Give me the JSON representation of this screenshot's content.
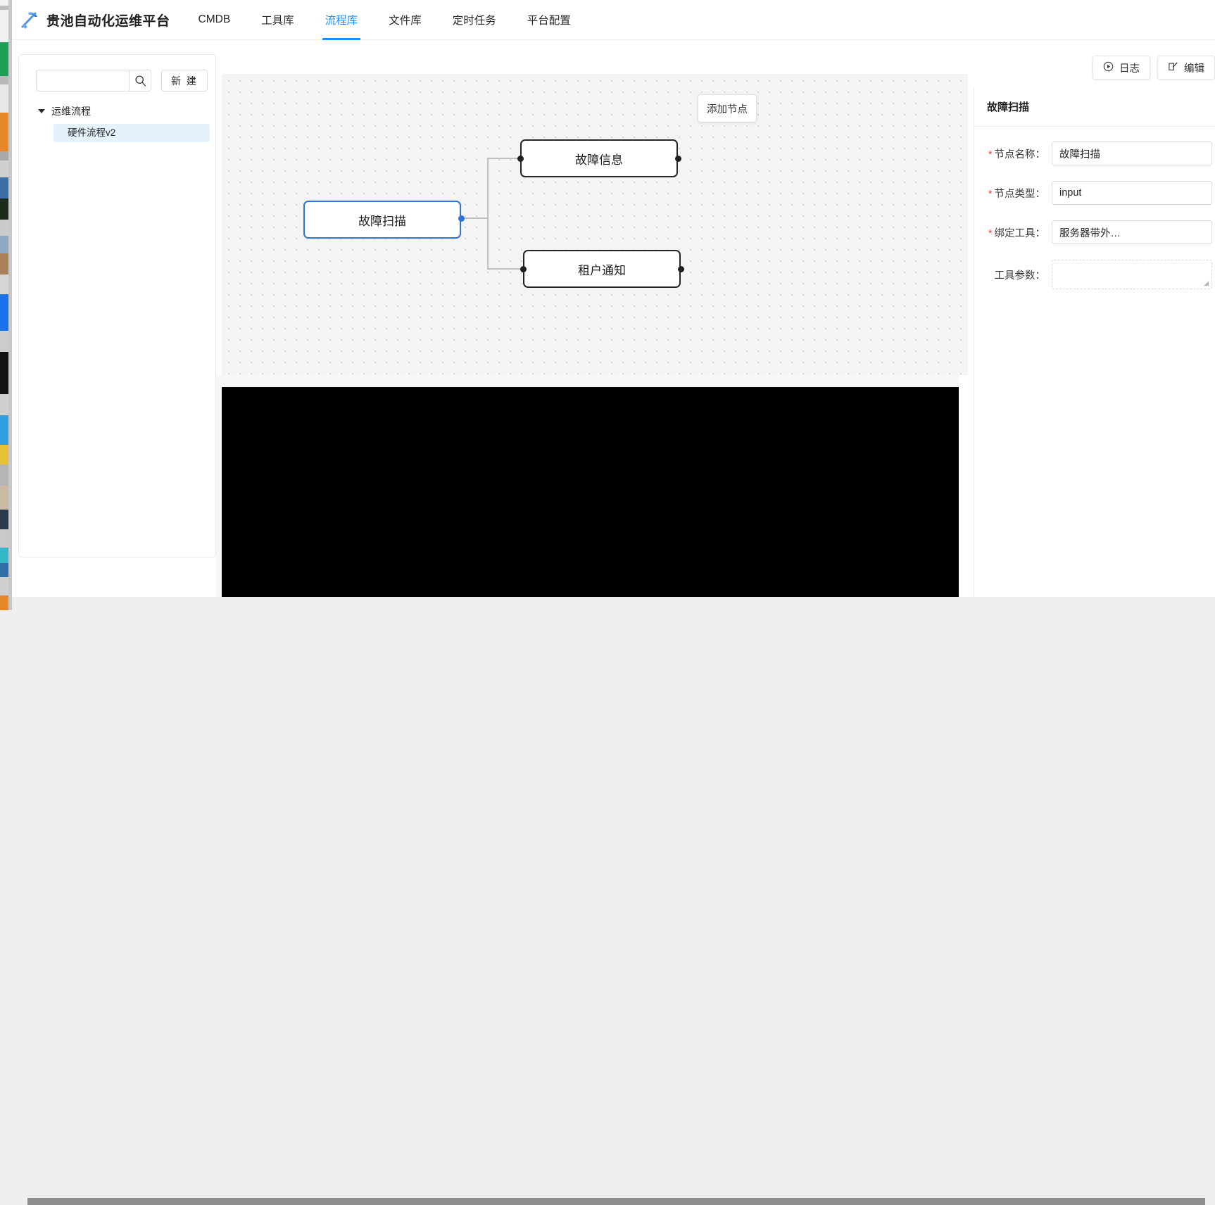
{
  "app": {
    "brand": "贵池自动化运维平台",
    "logo_icon": "pickaxe-logo-icon"
  },
  "nav": {
    "tabs": [
      {
        "label": "CMDB",
        "active": false
      },
      {
        "label": "工具库",
        "active": false
      },
      {
        "label": "流程库",
        "active": true
      },
      {
        "label": "文件库",
        "active": false
      },
      {
        "label": "定时任务",
        "active": false
      },
      {
        "label": "平台配置",
        "active": false
      }
    ],
    "active_color": "#1890ff"
  },
  "sidebar": {
    "search": {
      "value": "",
      "placeholder": ""
    },
    "search_icon": "search-icon",
    "new_button": "新 建",
    "tree": {
      "group_label": "运维流程",
      "caret_icon": "caret-down-icon",
      "children": [
        {
          "label": "硬件流程v2",
          "selected": true
        }
      ]
    }
  },
  "canvas": {
    "add_node_button": "添加节点",
    "nodes": [
      {
        "id": "n1",
        "label": "故障扫描",
        "selected": true
      },
      {
        "id": "n2",
        "label": "故障信息",
        "selected": false
      },
      {
        "id": "n3",
        "label": "租户通知",
        "selected": false
      }
    ],
    "selected_border_color": "#2f73d8",
    "node_border_color": "#22252a"
  },
  "toolbar": {
    "log_button": "日志",
    "log_icon": "play-circle-icon",
    "edit_button": "编辑",
    "edit_icon": "pencil-square-icon"
  },
  "properties": {
    "title": "故障扫描",
    "fields": [
      {
        "required": true,
        "label": "节点名称：",
        "value": "故障扫描",
        "type": "input"
      },
      {
        "required": true,
        "label": "节点类型：",
        "value": "input",
        "type": "input"
      },
      {
        "required": true,
        "label": "绑定工具：",
        "value": "服务器带外…",
        "type": "input"
      },
      {
        "required": false,
        "label": "工具参数：",
        "value": "",
        "type": "textarea"
      }
    ]
  }
}
